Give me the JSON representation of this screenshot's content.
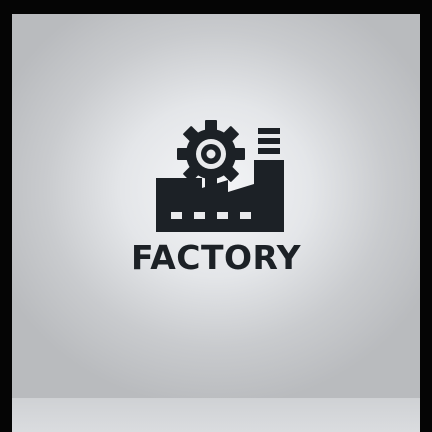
{
  "logo": {
    "wordmark": "FACTORY",
    "icon": "factory-gear-icon",
    "ink_color": "#1c2126",
    "background_color": "#e6e7e9"
  }
}
